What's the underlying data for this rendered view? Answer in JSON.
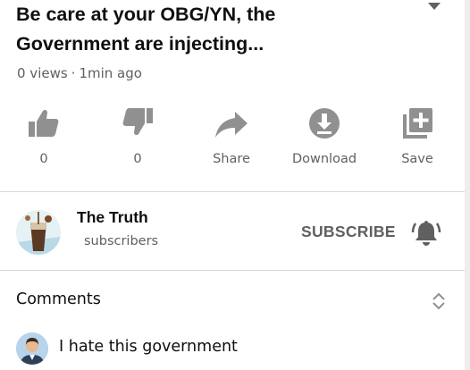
{
  "video": {
    "title": "Be care at your OBG/YN, the\nGovernment are injecting...",
    "views": "0 views",
    "separator": "·",
    "age": "1min ago"
  },
  "actions": {
    "like": {
      "icon": "thumbs-up-icon",
      "label": "0"
    },
    "dislike": {
      "icon": "thumbs-down-icon",
      "label": "0"
    },
    "share": {
      "icon": "share-arrow-icon",
      "label": "Share"
    },
    "download": {
      "icon": "download-icon",
      "label": "Download"
    },
    "save": {
      "icon": "playlist-add-icon",
      "label": "Save"
    }
  },
  "channel": {
    "name": "The Truth",
    "subscribers": "subscribers",
    "subscribe_label": "SUBSCRIBE",
    "bell_icon": "notification-bell-icon",
    "avatar_icon": "iced-coffee-avatar"
  },
  "comments": {
    "header": "Comments",
    "sort_icon": "expand-collapse-icon",
    "first_comment": {
      "avatar_icon": "user-avatar-icon",
      "text": "I hate this government"
    }
  },
  "colors": {
    "text_primary": "#0f0f0f",
    "text_secondary": "#606060",
    "icon_gray": "#909090",
    "divider": "#d9d9d9"
  }
}
